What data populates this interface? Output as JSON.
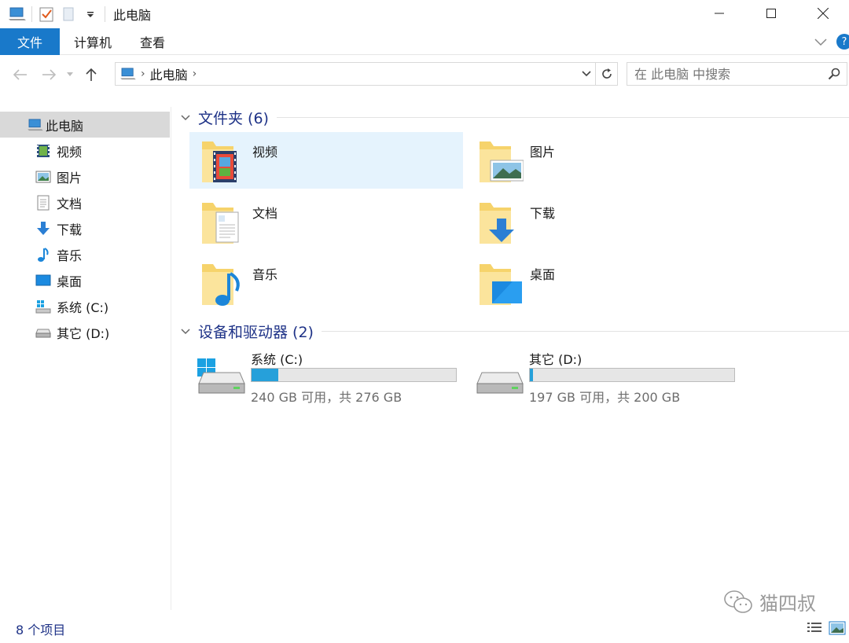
{
  "window": {
    "title": "此电脑"
  },
  "ribbon": {
    "tabs": [
      {
        "label": "文件",
        "active": true
      },
      {
        "label": "计算机"
      },
      {
        "label": "查看"
      }
    ],
    "help_glyph": "?"
  },
  "nav": {
    "breadcrumb": [
      "此电脑"
    ],
    "search_placeholder": "在 此电脑 中搜索"
  },
  "sidebar": {
    "root": {
      "label": "此电脑",
      "icon": "computer-icon"
    },
    "items": [
      {
        "label": "视频",
        "icon": "video-folder-icon"
      },
      {
        "label": "图片",
        "icon": "pictures-folder-icon"
      },
      {
        "label": "文档",
        "icon": "documents-folder-icon"
      },
      {
        "label": "下载",
        "icon": "downloads-icon"
      },
      {
        "label": "音乐",
        "icon": "music-icon"
      },
      {
        "label": "桌面",
        "icon": "desktop-icon"
      },
      {
        "label": "系统 (C:)",
        "icon": "windows-drive-icon"
      },
      {
        "label": "其它 (D:)",
        "icon": "drive-icon"
      }
    ]
  },
  "folders_group": {
    "title": "文件夹 (6)",
    "items": [
      {
        "label": "视频",
        "icon": "video-folder-icon",
        "selected": true
      },
      {
        "label": "图片",
        "icon": "pictures-folder-icon"
      },
      {
        "label": "文档",
        "icon": "documents-folder-icon"
      },
      {
        "label": "下载",
        "icon": "downloads-folder-icon"
      },
      {
        "label": "音乐",
        "icon": "music-folder-icon"
      },
      {
        "label": "桌面",
        "icon": "desktop-folder-icon"
      }
    ]
  },
  "drives_group": {
    "title": "设备和驱动器 (2)",
    "items": [
      {
        "label": "系统 (C:)",
        "free_text": "240 GB 可用，共 276 GB",
        "used_fraction": 0.13,
        "icon": "windows-drive-icon"
      },
      {
        "label": "其它 (D:)",
        "free_text": "197 GB 可用，共 200 GB",
        "used_fraction": 0.015,
        "icon": "drive-icon"
      }
    ]
  },
  "status": {
    "item_count": "8 个项目"
  },
  "watermark": {
    "text": "猫四叔"
  },
  "colors": {
    "accent": "#1979ca",
    "group_title": "#1e3287",
    "selection": "#e5f3fd",
    "drive_bar": "#26a0da",
    "folder": "#f6d36b"
  }
}
